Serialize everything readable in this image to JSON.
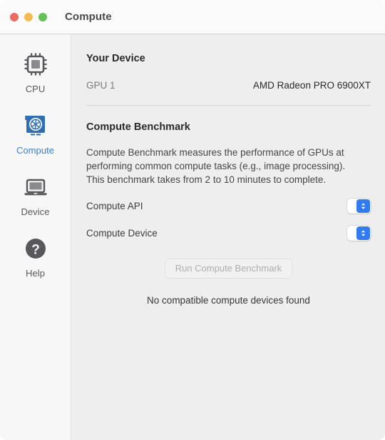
{
  "window": {
    "title": "Compute",
    "traffic_lights": [
      {
        "name": "close",
        "color": "#ed6a5e"
      },
      {
        "name": "minimize",
        "color": "#f4bd4f"
      },
      {
        "name": "zoom",
        "color": "#61c454"
      }
    ]
  },
  "sidebar": {
    "items": [
      {
        "label": "CPU",
        "icon": "cpu-chip-icon",
        "selected": false
      },
      {
        "label": "Compute",
        "icon": "gpu-aperture-icon",
        "selected": true
      },
      {
        "label": "Device",
        "icon": "laptop-icon",
        "selected": false
      },
      {
        "label": "Help",
        "icon": "question-mark-circle-icon",
        "selected": false
      }
    ],
    "selected_color": "#3b7fd4"
  },
  "content": {
    "device_section": {
      "title": "Your Device",
      "rows": [
        {
          "key": "GPU 1",
          "value": "AMD Radeon PRO 6900XT"
        }
      ]
    },
    "benchmark_section": {
      "title": "Compute Benchmark",
      "description": "Compute Benchmark measures the performance of GPUs at performing common compute tasks (e.g., image processing). This benchmark takes from 2 to 10 minutes to complete.",
      "fields": [
        {
          "label": "Compute API",
          "value": ""
        },
        {
          "label": "Compute Device",
          "value": ""
        }
      ],
      "run_button": {
        "label": "Run Compute Benchmark",
        "disabled": true
      },
      "status": "No compatible compute devices found"
    }
  }
}
